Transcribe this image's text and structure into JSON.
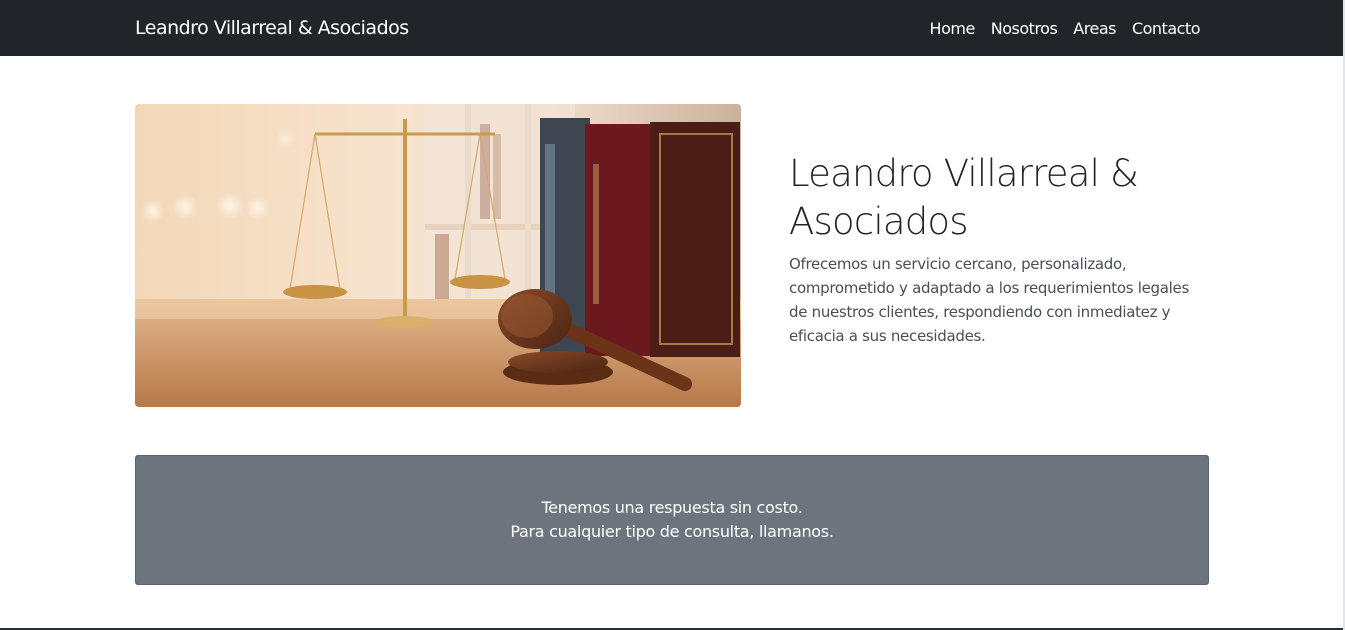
{
  "navbar": {
    "brand": "Leandro Villarreal & Asociados",
    "items": [
      {
        "label": "Home"
      },
      {
        "label": "Nosotros"
      },
      {
        "label": "Areas"
      },
      {
        "label": "Contacto"
      }
    ],
    "background": "#212529"
  },
  "hero": {
    "image_subject": "law-scales-gavel-books-photo",
    "title": "Leandro Villarreal & Asociados",
    "text": "Ofrecemos un servicio cercano, personalizado, comprometido y adaptado a los requerimientos legales de nuestros clientes, respondiendo con inmediatez y eficacia a sus necesidades."
  },
  "callout": {
    "line1": "Tenemos una respuesta sin costo.",
    "line2": "Para cualquier tipo de consulta, llamanos.",
    "background": "#6c757d"
  }
}
